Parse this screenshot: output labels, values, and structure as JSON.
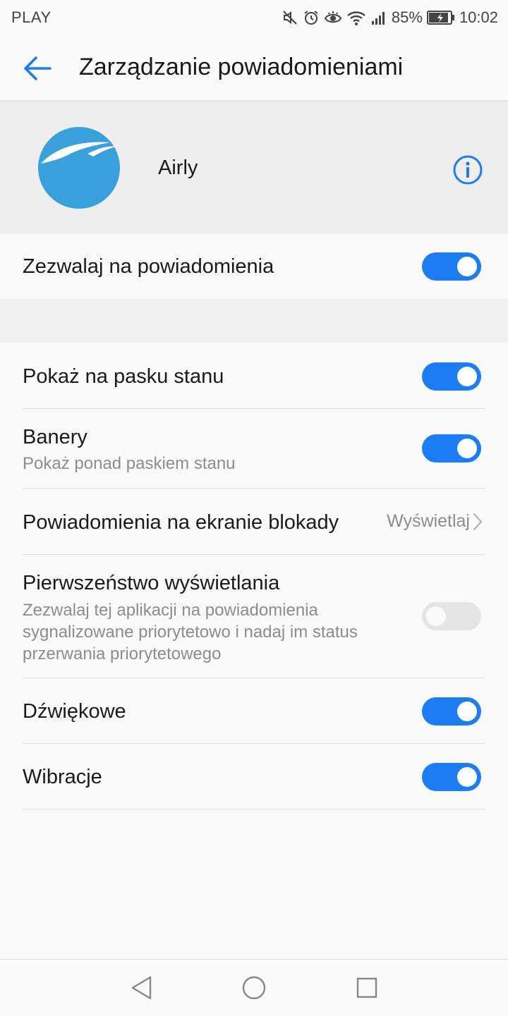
{
  "status_bar": {
    "carrier": "PLAY",
    "battery": "85%",
    "time": "10:02"
  },
  "header": {
    "title": "Zarządzanie powiadomieniami"
  },
  "app": {
    "name": "Airly"
  },
  "allow": {
    "label": "Zezwalaj na powiadomienia",
    "enabled": true
  },
  "settings": [
    {
      "title": "Pokaż na pasku stanu",
      "enabled": true
    },
    {
      "title": "Banery",
      "subtitle": "Pokaż ponad paskiem stanu",
      "enabled": true
    },
    {
      "title": "Powiadomienia na ekranie blokady",
      "value": "Wyświetlaj"
    },
    {
      "title": "Pierwszeństwo wyświetlania",
      "subtitle": "Zezwalaj tej aplikacji na powiadomienia sygnalizowane priorytetowo i nadaj im status przerwania priorytetowego",
      "enabled": false
    },
    {
      "title": "Dźwiękowe",
      "enabled": true
    },
    {
      "title": "Wibracje",
      "enabled": true
    }
  ],
  "colors": {
    "accent": "#1b7cf4",
    "logo": "#3aa0dc",
    "header_bg": "#eeeeee"
  }
}
